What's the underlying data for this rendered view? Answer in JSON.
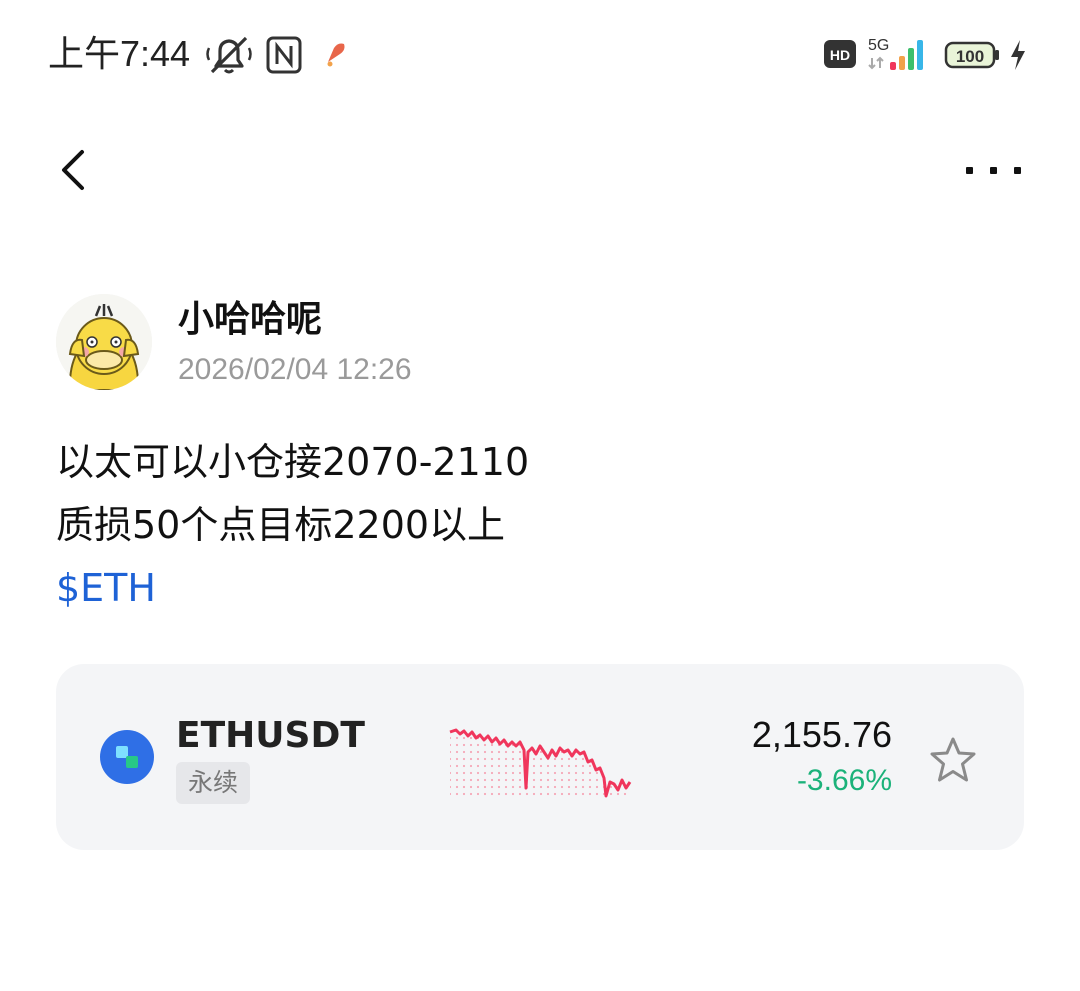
{
  "status_bar": {
    "time": "上午7:44",
    "network": "5G",
    "hd": "HD",
    "battery": "100",
    "icons": [
      "bell-muted-icon",
      "nfc-icon",
      "app-notification-icon",
      "hd-icon",
      "signal-icon",
      "battery-icon",
      "charging-icon"
    ]
  },
  "nav": {
    "back_icon": "chevron-left-icon",
    "more_icon": "more-dots-icon"
  },
  "post": {
    "author": "小哈哈呢",
    "timestamp": "2026/02/04 12:26",
    "lines": [
      "以太可以小仓接2070-2110",
      "质损50个点目标2200以上"
    ],
    "tag": "$ETH"
  },
  "ticker_card": {
    "symbol": "ETHUSDT",
    "type": "永续",
    "price": "2,155.76",
    "change": "-3.66%",
    "colors": {
      "change": "#1bb27a",
      "sparkline": "#f0365c",
      "coin_icon": "#2f6fe6"
    },
    "favorite_icon": "star-outline-icon"
  }
}
